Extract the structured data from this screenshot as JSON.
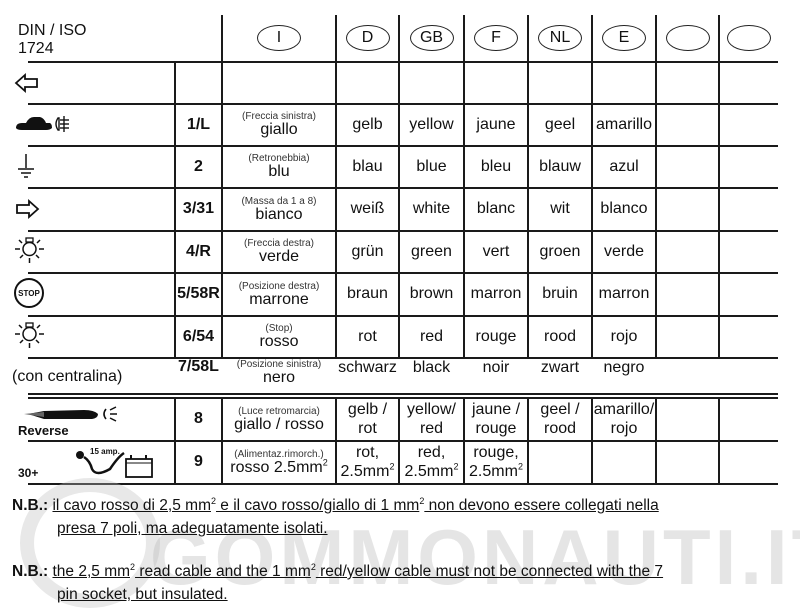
{
  "header": {
    "standard_line1": "DIN / ISO",
    "standard_line2": "1724",
    "languages": [
      "I",
      "D",
      "GB",
      "F",
      "NL",
      "E",
      "",
      ""
    ]
  },
  "rows": [
    {
      "icon": "arrow-left-icon",
      "pin": "1/L",
      "note": "(Freccia sinistra)",
      "it": "giallo",
      "de": "gelb",
      "en": "yellow",
      "fr": "jaune",
      "nl": "geel",
      "es": "amarillo"
    },
    {
      "icon": "rear-fog-light-icon",
      "pin": "2",
      "note": "(Retronebbia)",
      "it": "blu",
      "de": "blau",
      "en": "blue",
      "fr": "bleu",
      "nl": "blauw",
      "es": "azul"
    },
    {
      "icon": "ground-icon",
      "pin": "3/31",
      "note": "(Massa da 1 a 8)",
      "it": "bianco",
      "de": "weiß",
      "en": "white",
      "fr": "blanc",
      "nl": "wit",
      "es": "blanco"
    },
    {
      "icon": "arrow-right-icon",
      "pin": "4/R",
      "note": "(Freccia destra)",
      "it": "verde",
      "de": "grün",
      "en": "green",
      "fr": "vert",
      "nl": "groen",
      "es": "verde"
    },
    {
      "icon": "position-light-icon",
      "pin": "5/58R",
      "note": "(Posizione destra)",
      "it": "marrone",
      "de": "braun",
      "en": "brown",
      "fr": "marron",
      "nl": "bruin",
      "es": "marron"
    },
    {
      "icon": "stop-icon",
      "pin": "6/54",
      "note": "(Stop)",
      "it": "rosso",
      "de": "rot",
      "en": "red",
      "fr": "rouge",
      "nl": "rood",
      "es": "rojo"
    },
    {
      "icon": "position-light-icon",
      "pin": "7/58L",
      "note": "(Posizione sinistra)",
      "it": "nero",
      "de": "schwarz",
      "en": "black",
      "fr": "noir",
      "nl": "zwart",
      "es": "negro"
    }
  ],
  "section_label": "(con centralina)",
  "stop_icon_text": "STOP",
  "rows2": [
    {
      "icon": "reverse-light-icon",
      "icon_label": "Reverse",
      "pin": "8",
      "note": "(Luce retromarcia)",
      "it": "giallo / rosso",
      "de": [
        "gelb /",
        "rot"
      ],
      "en": [
        "yellow/",
        "red"
      ],
      "fr": [
        "jaune /",
        "rouge"
      ],
      "nl": [
        "geel /",
        "rood"
      ],
      "es": [
        "amarillo/",
        "rojo"
      ]
    },
    {
      "icon": "battery-supply-icon",
      "icon_label": "30+",
      "icon_sublabel": "15 amp.",
      "pin": "9",
      "note": "(Alimentaz.rimorch.)",
      "it": "rosso 2.5mm",
      "de": [
        "rot,",
        "2.5mm"
      ],
      "en": [
        "red,",
        "2.5mm"
      ],
      "fr": [
        "rouge,",
        "2.5mm"
      ],
      "nl": [
        "",
        ""
      ],
      "es": [
        "",
        ""
      ]
    }
  ],
  "notes": {
    "label": "N.B.:",
    "it_parts": [
      "il cavo rosso di 2,5 mm",
      "2",
      " e il cavo rosso/giallo di 1 mm",
      "2",
      " non devono essere collegati nella",
      "presa 7 poli, ma adeguatamente isolati."
    ],
    "en_parts": [
      "the 2,5 mm",
      "2",
      " read cable and the 1 mm",
      "2",
      " red/yellow cable must not be connected with the 7",
      "pin socket, but insulated."
    ]
  },
  "watermark": "GOMMONAUTI.IT",
  "superscript": "2"
}
